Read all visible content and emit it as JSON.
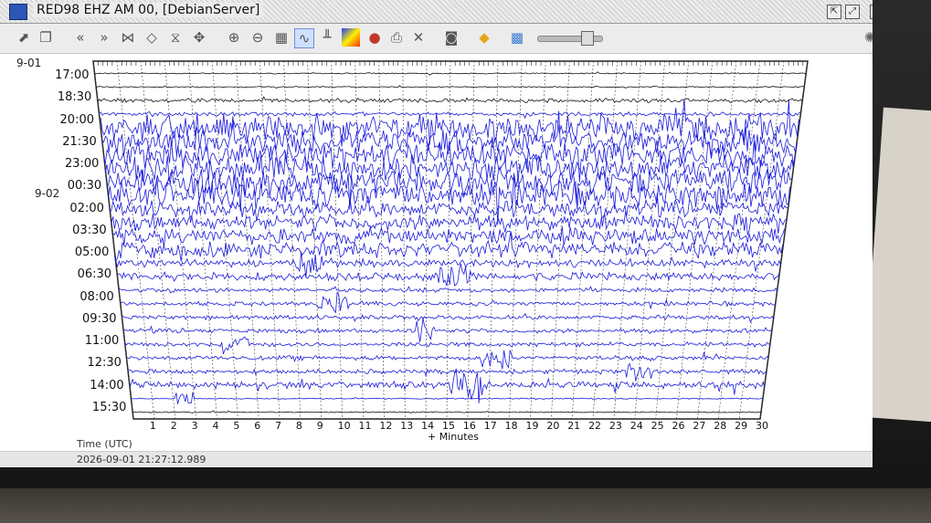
{
  "window": {
    "title": "RED98 EHZ AM 00, [DebianServer]"
  },
  "toolbar": {
    "icons": [
      "export-icon",
      "copy-icon",
      "rewind-fast-icon",
      "forward-fast-icon",
      "collapse-icon",
      "expand-icon",
      "zoom-fit-icon",
      "move-icon",
      "zoom-in-icon",
      "zoom-out-icon",
      "table-icon",
      "waveform-icon",
      "spectrum-icon",
      "spectrogram-icon",
      "filter-icon",
      "print-icon",
      "close-icon",
      "camera-icon",
      "tag-icon",
      "map-icon"
    ]
  },
  "helicorder": {
    "dates": [
      "9-01",
      "9-02"
    ],
    "row_times": [
      "17:00",
      "18:30",
      "20:00",
      "21:30",
      "23:00",
      "00:30",
      "02:00",
      "03:30",
      "05:00",
      "06:30",
      "08:00",
      "09:30",
      "11:00",
      "12:30",
      "14:00",
      "15:30"
    ],
    "x_ticks": [
      "1",
      "2",
      "3",
      "4",
      "5",
      "6",
      "7",
      "8",
      "9",
      "10",
      "11",
      "12",
      "13",
      "14",
      "15",
      "16",
      "17",
      "18",
      "19",
      "20",
      "21",
      "22",
      "23",
      "24",
      "25",
      "26",
      "27",
      "28",
      "29",
      "30"
    ],
    "x_axis_label": "+ Minutes",
    "y_axis_label": "Time (UTC)",
    "trace_color": "#1a1adc",
    "grid_color": "#444444"
  },
  "status": {
    "timestamp": "2026-09-01 21:27:12.989"
  }
}
